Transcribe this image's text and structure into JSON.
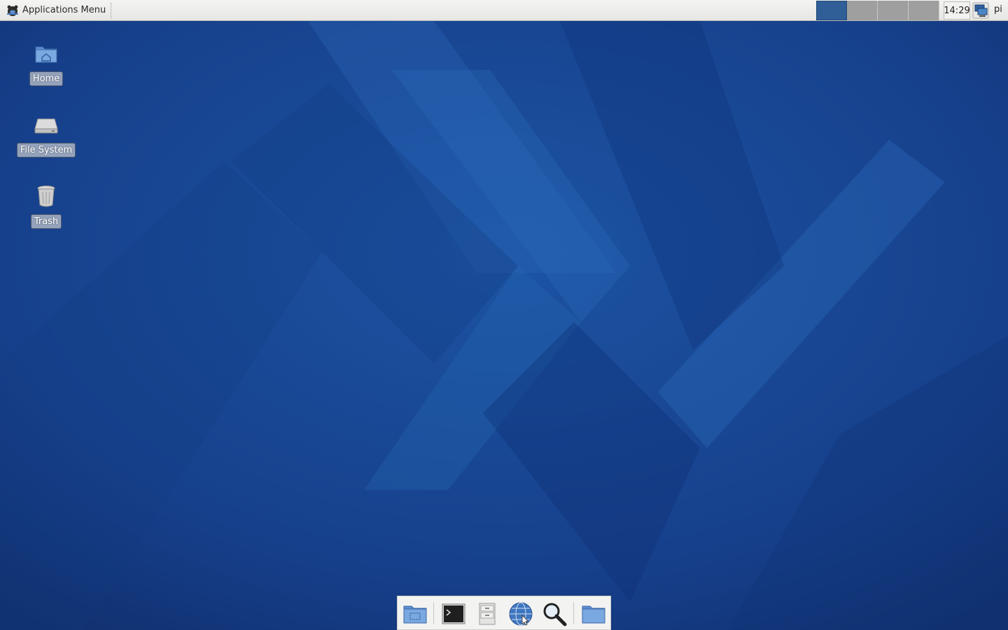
{
  "top_panel": {
    "app_menu_label": "Applications Menu",
    "workspaces": [
      {
        "active": true
      },
      {
        "active": false
      },
      {
        "active": false
      },
      {
        "active": false
      }
    ],
    "clock_text": "14:29",
    "network_icon": "network-icon",
    "user_name": "pi"
  },
  "desktop_icons": [
    {
      "label": "Home",
      "icon": "home-folder-icon"
    },
    {
      "label": "File System",
      "icon": "drive-icon"
    },
    {
      "label": "Trash",
      "icon": "trash-icon"
    }
  ],
  "dock": {
    "items": [
      {
        "icon": "show-desktop-icon"
      },
      {
        "icon": "terminal-icon"
      },
      {
        "icon": "file-manager-icon"
      },
      {
        "icon": "web-browser-icon"
      },
      {
        "icon": "search-icon"
      },
      {
        "icon": "folder-icon"
      }
    ]
  },
  "colors": {
    "wallpaper_base": "#16408a",
    "workspace_active": "#2f5f96",
    "workspace_inactive": "#9f9f9f",
    "panel_bg": "#eeeeec"
  }
}
